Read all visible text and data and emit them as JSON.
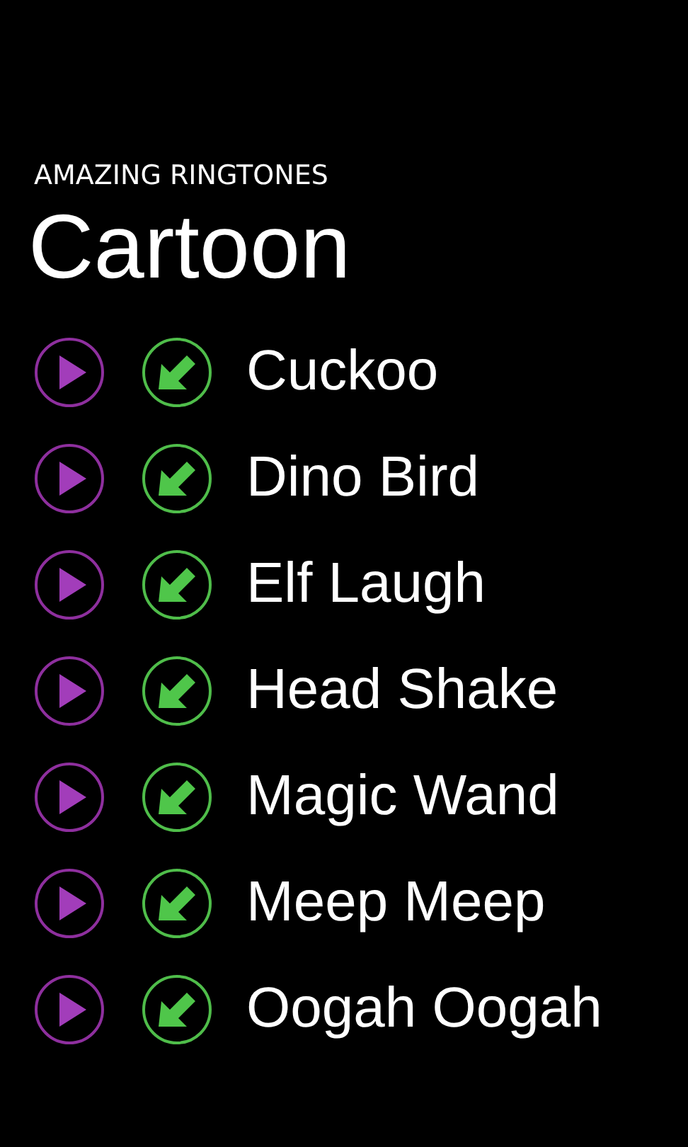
{
  "app_title": "AMAZING RINGTONES",
  "page_title": "Cartoon",
  "ringtones": [
    {
      "name": "Cuckoo"
    },
    {
      "name": "Dino Bird"
    },
    {
      "name": "Elf Laugh"
    },
    {
      "name": "Head Shake"
    },
    {
      "name": "Magic Wand"
    },
    {
      "name": "Meep Meep"
    },
    {
      "name": "Oogah Oogah"
    }
  ]
}
